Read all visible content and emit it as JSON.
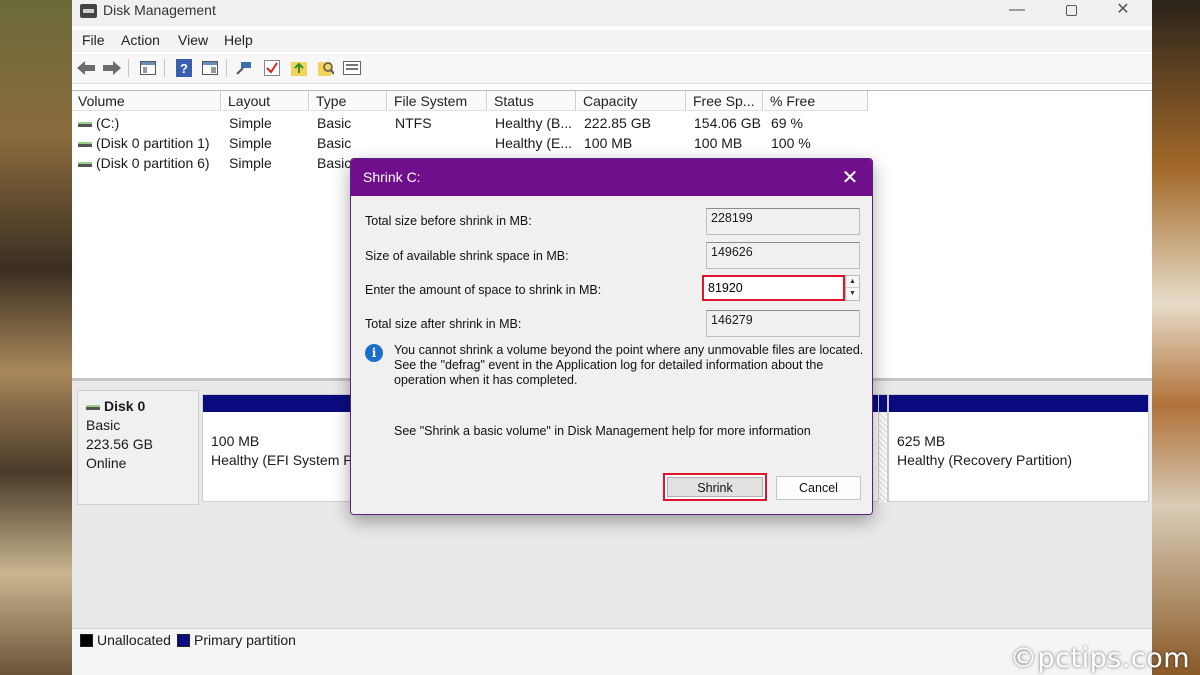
{
  "window": {
    "title": "Disk Management",
    "controls": {
      "minimize": "—",
      "close": "✕"
    }
  },
  "menu": [
    "File",
    "Action",
    "View",
    "Help"
  ],
  "toolbar_icons": [
    "back-arrow-icon",
    "forward-arrow-icon",
    "console-tree-icon",
    "help-icon",
    "properties-icon",
    "connect-icon",
    "check-icon",
    "rescan-icon",
    "search-icon",
    "list-icon"
  ],
  "volume_table": {
    "headers": [
      "Volume",
      "Layout",
      "Type",
      "File System",
      "Status",
      "Capacity",
      "Free Sp...",
      "% Free"
    ],
    "rows": [
      {
        "volume": "(C:)",
        "layout": "Simple",
        "type": "Basic",
        "fs": "NTFS",
        "status": "Healthy (B...",
        "capacity": "222.85 GB",
        "free": "154.06 GB",
        "pct": "69 %"
      },
      {
        "volume": "(Disk 0 partition 1)",
        "layout": "Simple",
        "type": "Basic",
        "fs": "",
        "status": "Healthy (E...",
        "capacity": "100 MB",
        "free": "100 MB",
        "pct": "100 %"
      },
      {
        "volume": "(Disk 0 partition 6)",
        "layout": "Simple",
        "type": "Basic",
        "fs": "",
        "status": "",
        "capacity": "",
        "free": "",
        "pct": ""
      }
    ]
  },
  "disk": {
    "name": "Disk 0",
    "type": "Basic",
    "size": "223.56 GB",
    "state": "Online",
    "partitions": [
      {
        "size": "100 MB",
        "status": "Healthy (EFI System Pa"
      },
      {
        "size": "625 MB",
        "status": "Healthy (Recovery Partition)"
      }
    ]
  },
  "legend": [
    {
      "label": "Unallocated",
      "color": "#000000"
    },
    {
      "label": "Primary partition",
      "color": "#0b0b80"
    }
  ],
  "dialog": {
    "title": "Shrink C:",
    "close": "✕",
    "fields": {
      "total_before_label": "Total size before shrink in MB:",
      "total_before_value": "228199",
      "available_label": "Size of available shrink space in MB:",
      "available_value": "149626",
      "amount_label": "Enter the amount of space to shrink in MB:",
      "amount_value": "81920",
      "total_after_label": "Total size after shrink in MB:",
      "total_after_value": "146279"
    },
    "info_text": "You cannot shrink a volume beyond the point where any unmovable files are located. See the \"defrag\" event in the Application log for detailed information about the operation when it has completed.",
    "help_text": "See \"Shrink a basic volume\" in Disk Management help for more information",
    "buttons": {
      "shrink": "Shrink",
      "cancel": "Cancel"
    }
  },
  "watermark": "©pctips.com",
  "colors": {
    "dialog_title": "#6f0f8c",
    "highlight": "#e0142a",
    "partition_bar": "#0b0b80"
  }
}
